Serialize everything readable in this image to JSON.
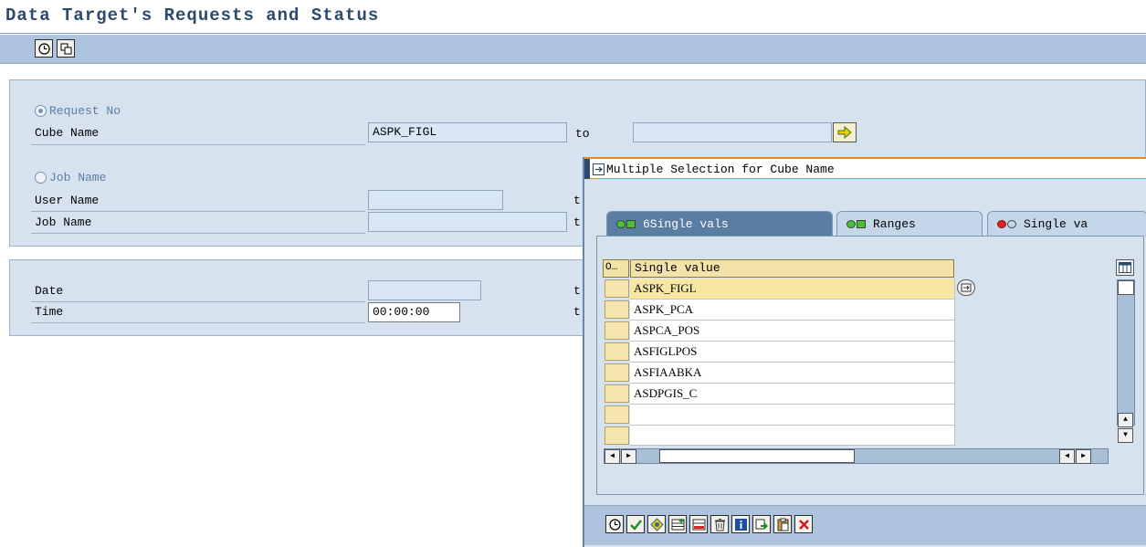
{
  "page": {
    "title": "Data Target's Requests and Status"
  },
  "toolbar": {
    "buttons": [
      "execute-icon",
      "copy-icon"
    ]
  },
  "request_group": {
    "request_no": {
      "label": "Request No",
      "selected": true
    },
    "cube_name": {
      "label": "Cube Name",
      "from_value": "ASPK_FIGL",
      "to_label": "to",
      "to_value": ""
    },
    "job_name": {
      "label": "Job Name",
      "selected": false
    },
    "user_name": {
      "label": "User Name",
      "value": "",
      "to_label": "t"
    },
    "job_name_field": {
      "label": "Job Name",
      "value": "",
      "to_label": "t"
    }
  },
  "datetime_group": {
    "date": {
      "label": "Date",
      "value": "",
      "to_label": "t"
    },
    "time": {
      "label": "Time",
      "value": "00:00:00",
      "to_label": "t"
    }
  },
  "dialog": {
    "title": "Multiple Selection for Cube Name",
    "tabs": [
      {
        "label": "6Single vals",
        "active": true,
        "indicator": "green"
      },
      {
        "label": "Ranges",
        "active": false,
        "indicator": "green"
      },
      {
        "label": "Single va",
        "active": false,
        "indicator": "red"
      }
    ],
    "table": {
      "sel_header": "O…",
      "column_header": "Single value",
      "rows": [
        "ASPK_FIGL",
        "ASPK_PCA",
        "ASPCA_POS",
        "ASFIGLPOS",
        "ASFIAABKA",
        "ASDPGIS_C",
        "",
        ""
      ]
    },
    "footer_buttons": [
      "execute-icon",
      "checkmark-icon",
      "multiple-selection-icon",
      "insert-row-icon",
      "delete-row-icon",
      "trash-icon",
      "info-icon",
      "import-icon",
      "paste-icon",
      "cancel-icon"
    ]
  }
}
